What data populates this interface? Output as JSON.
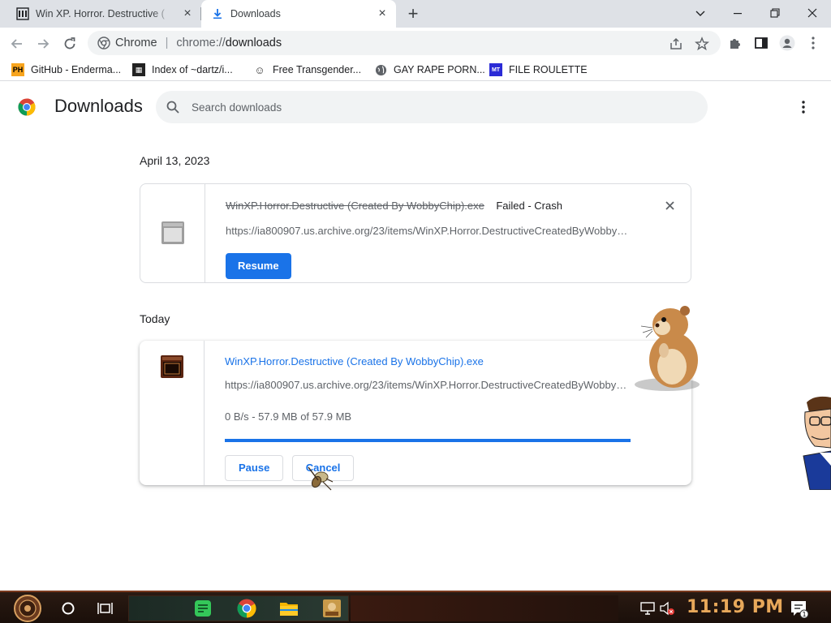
{
  "tabs": [
    {
      "title": "Win XP. Horror. Destructive (",
      "icon": "archive-icon"
    },
    {
      "title": "Downloads",
      "icon": "download-icon"
    }
  ],
  "omnibox": {
    "site_label": "Chrome",
    "url_scheme": "chrome://",
    "url_path": "downloads"
  },
  "bookmarks": [
    {
      "label": "GitHub - Enderma...",
      "icon": "ph-icon"
    },
    {
      "label": "Index of ~dartz/i...",
      "icon": "grid-icon"
    },
    {
      "label": "Free Transgender...",
      "icon": "mask-icon"
    },
    {
      "label": "GAY RAPE PORN...",
      "icon": "globe-icon"
    },
    {
      "label": "FILE ROULETTE",
      "icon": "roulette-icon"
    }
  ],
  "page": {
    "title": "Downloads",
    "search_placeholder": "Search downloads"
  },
  "groups": [
    {
      "date": "April 13, 2023",
      "item": {
        "filename": "WinXP.Horror.Destructive (Created By WobbyChip).exe",
        "status": "Failed - Crash",
        "url": "https://ia800907.us.archive.org/23/items/WinXP.Horror.DestructiveCreatedByWobbyChip/WinXP.Horror.Destructive%20(Created%20By%20WobbyChip).exe",
        "action_label": "Resume"
      }
    },
    {
      "date": "Today",
      "item": {
        "filename": "WinXP.Horror.Destructive (Created By WobbyChip).exe",
        "url": "https://ia800907.us.archive.org/23/items/WinXP.Horror.DestructiveCreatedByWobbyChip/WinXP.Horror.Destructive%20(Created%20By%20WobbyChip).exe",
        "progress_text": "0 B/s - 57.9 MB of 57.9 MB",
        "progress_fraction": 1.0,
        "pause_label": "Pause",
        "cancel_label": "Cancel"
      }
    }
  ],
  "taskbar": {
    "clock": "11:19 PM",
    "apps": [
      "notes-icon",
      "chrome-icon",
      "folder-icon",
      "game-icon"
    ]
  },
  "colors": {
    "accent": "#1a73e8",
    "tabstrip": "#dee1e6",
    "clock": "#e8a85a"
  }
}
